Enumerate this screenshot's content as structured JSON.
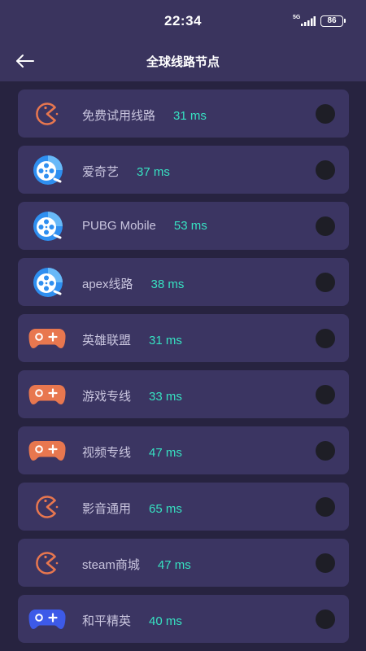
{
  "status_bar": {
    "time": "22:34",
    "network": "5G",
    "battery": "86"
  },
  "header": {
    "title": "全球线路节点",
    "back_icon": "arrow-left-icon"
  },
  "colors": {
    "background": "#272340",
    "card": "#3b3562",
    "latency": "#37e2c2",
    "icon_orange": "#e8774f",
    "icon_blue": "#2f8ff0",
    "icon_indigo": "#3d5ae8"
  },
  "routes": [
    {
      "name": "免费试用线路",
      "latency": "31 ms",
      "icon": "pacman-icon"
    },
    {
      "name": "爱奇艺",
      "latency": "37 ms",
      "icon": "film-reel-icon"
    },
    {
      "name": "PUBG Mobile",
      "latency": "53 ms",
      "icon": "film-reel-icon"
    },
    {
      "name": "apex线路",
      "latency": "38 ms",
      "icon": "film-reel-icon"
    },
    {
      "name": "英雄联盟",
      "latency": "31 ms",
      "icon": "gamepad-icon"
    },
    {
      "name": "游戏专线",
      "latency": "33 ms",
      "icon": "gamepad-icon"
    },
    {
      "name": "视频专线",
      "latency": "47 ms",
      "icon": "gamepad-icon"
    },
    {
      "name": "影音通用",
      "latency": "65 ms",
      "icon": "pacman-icon"
    },
    {
      "name": "steam商城",
      "latency": "47 ms",
      "icon": "pacman-icon"
    },
    {
      "name": "和平精英",
      "latency": "40 ms",
      "icon": "gamepad-blue-icon"
    }
  ]
}
